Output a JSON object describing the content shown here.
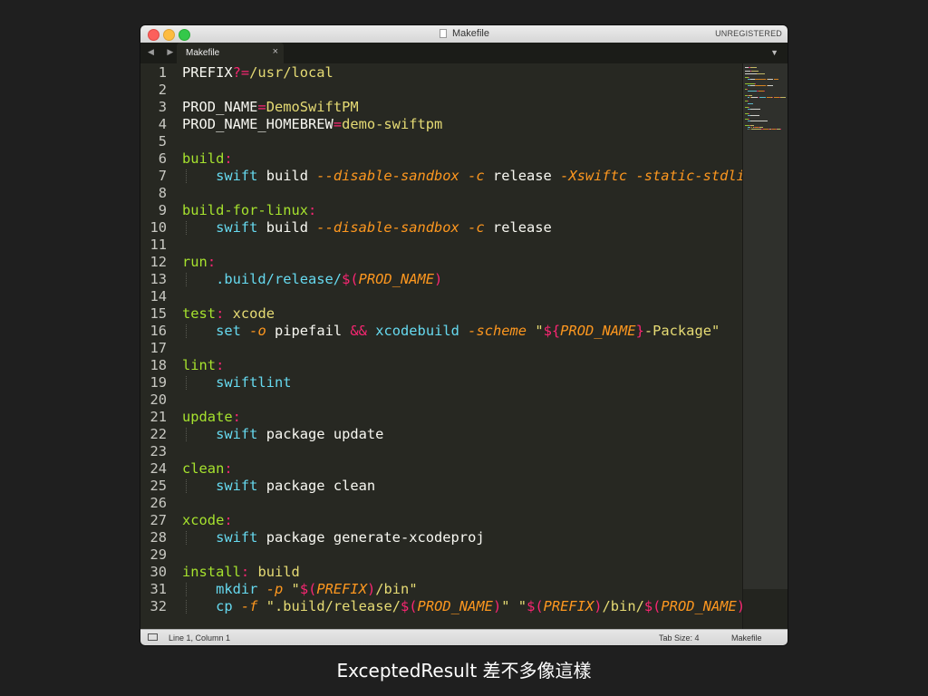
{
  "window": {
    "title": "Makefile",
    "registration": "UNREGISTERED"
  },
  "tabs": [
    {
      "label": "Makefile",
      "close": "×",
      "active": true
    }
  ],
  "tab_nav": {
    "arrows": "◀ ▶",
    "menu": "▼"
  },
  "code_lines": [
    {
      "n": "1",
      "tokens": [
        [
          "w",
          "PREFIX"
        ],
        [
          "p",
          "?="
        ],
        [
          "s",
          "/usr/local"
        ]
      ]
    },
    {
      "n": "2",
      "tokens": []
    },
    {
      "n": "3",
      "tokens": [
        [
          "w",
          "PROD_NAME"
        ],
        [
          "p",
          "="
        ],
        [
          "s",
          "DemoSwiftPM"
        ]
      ]
    },
    {
      "n": "4",
      "tokens": [
        [
          "w",
          "PROD_NAME_HOMEBREW"
        ],
        [
          "p",
          "="
        ],
        [
          "s",
          "demo-swiftpm"
        ]
      ]
    },
    {
      "n": "5",
      "tokens": []
    },
    {
      "n": "6",
      "tokens": [
        [
          "t",
          "build"
        ],
        [
          "p",
          ":"
        ]
      ]
    },
    {
      "n": "7",
      "guide": true,
      "tokens": [
        [
          "w",
          "    "
        ],
        [
          "c",
          "swift"
        ],
        [
          "w",
          " build "
        ],
        [
          "o",
          "--disable-sandbox"
        ],
        [
          "w",
          " "
        ],
        [
          "o",
          "-c"
        ],
        [
          "w",
          " release "
        ],
        [
          "o",
          "-Xswiftc"
        ],
        [
          "w",
          " "
        ],
        [
          "o",
          "-static-stdlib"
        ]
      ]
    },
    {
      "n": "8",
      "tokens": []
    },
    {
      "n": "9",
      "tokens": [
        [
          "t",
          "build-for-linux"
        ],
        [
          "p",
          ":"
        ]
      ]
    },
    {
      "n": "10",
      "guide": true,
      "tokens": [
        [
          "w",
          "    "
        ],
        [
          "c",
          "swift"
        ],
        [
          "w",
          " build "
        ],
        [
          "o",
          "--disable-sandbox"
        ],
        [
          "w",
          " "
        ],
        [
          "o",
          "-c"
        ],
        [
          "w",
          " release"
        ]
      ]
    },
    {
      "n": "11",
      "tokens": []
    },
    {
      "n": "12",
      "tokens": [
        [
          "t",
          "run"
        ],
        [
          "p",
          ":"
        ]
      ]
    },
    {
      "n": "13",
      "guide": true,
      "tokens": [
        [
          "w",
          "    "
        ],
        [
          "c",
          ".build/release/"
        ],
        [
          "p",
          "$("
        ],
        [
          "o",
          "PROD_NAME"
        ],
        [
          "p",
          ")"
        ]
      ]
    },
    {
      "n": "14",
      "tokens": []
    },
    {
      "n": "15",
      "tokens": [
        [
          "t",
          "test"
        ],
        [
          "p",
          ":"
        ],
        [
          "w",
          " "
        ],
        [
          "s",
          "xcode"
        ]
      ]
    },
    {
      "n": "16",
      "guide": true,
      "tokens": [
        [
          "w",
          "    "
        ],
        [
          "c",
          "set"
        ],
        [
          "w",
          " "
        ],
        [
          "o",
          "-o"
        ],
        [
          "w",
          " pipefail "
        ],
        [
          "p",
          "&&"
        ],
        [
          "w",
          " "
        ],
        [
          "c",
          "xcodebuild"
        ],
        [
          "w",
          " "
        ],
        [
          "o",
          "-scheme"
        ],
        [
          "w",
          " "
        ],
        [
          "s",
          "\""
        ],
        [
          "p",
          "${"
        ],
        [
          "o",
          "PROD_NAME"
        ],
        [
          "p",
          "}"
        ],
        [
          "s",
          "-Package\""
        ]
      ]
    },
    {
      "n": "17",
      "tokens": []
    },
    {
      "n": "18",
      "tokens": [
        [
          "t",
          "lint"
        ],
        [
          "p",
          ":"
        ]
      ]
    },
    {
      "n": "19",
      "guide": true,
      "tokens": [
        [
          "w",
          "    "
        ],
        [
          "c",
          "swiftlint"
        ]
      ]
    },
    {
      "n": "20",
      "tokens": []
    },
    {
      "n": "21",
      "tokens": [
        [
          "t",
          "update"
        ],
        [
          "p",
          ":"
        ]
      ]
    },
    {
      "n": "22",
      "guide": true,
      "tokens": [
        [
          "w",
          "    "
        ],
        [
          "c",
          "swift"
        ],
        [
          "w",
          " package update"
        ]
      ]
    },
    {
      "n": "23",
      "tokens": []
    },
    {
      "n": "24",
      "tokens": [
        [
          "t",
          "clean"
        ],
        [
          "p",
          ":"
        ]
      ]
    },
    {
      "n": "25",
      "guide": true,
      "tokens": [
        [
          "w",
          "    "
        ],
        [
          "c",
          "swift"
        ],
        [
          "w",
          " package clean"
        ]
      ]
    },
    {
      "n": "26",
      "tokens": []
    },
    {
      "n": "27",
      "tokens": [
        [
          "t",
          "xcode"
        ],
        [
          "p",
          ":"
        ]
      ]
    },
    {
      "n": "28",
      "guide": true,
      "tokens": [
        [
          "w",
          "    "
        ],
        [
          "c",
          "swift"
        ],
        [
          "w",
          " package generate-xcodeproj"
        ]
      ]
    },
    {
      "n": "29",
      "tokens": []
    },
    {
      "n": "30",
      "tokens": [
        [
          "t",
          "install"
        ],
        [
          "p",
          ":"
        ],
        [
          "w",
          " "
        ],
        [
          "s",
          "build"
        ]
      ]
    },
    {
      "n": "31",
      "guide": true,
      "tokens": [
        [
          "w",
          "    "
        ],
        [
          "c",
          "mkdir"
        ],
        [
          "w",
          " "
        ],
        [
          "o",
          "-p"
        ],
        [
          "w",
          " "
        ],
        [
          "s",
          "\""
        ],
        [
          "p",
          "$("
        ],
        [
          "o",
          "PREFIX"
        ],
        [
          "p",
          ")"
        ],
        [
          "s",
          "/bin\""
        ]
      ]
    },
    {
      "n": "32",
      "guide": true,
      "tokens": [
        [
          "w",
          "    "
        ],
        [
          "c",
          "cp"
        ],
        [
          "w",
          " "
        ],
        [
          "o",
          "-f"
        ],
        [
          "w",
          " "
        ],
        [
          "s",
          "\".build/release/"
        ],
        [
          "p",
          "$("
        ],
        [
          "o",
          "PROD_NAME"
        ],
        [
          "p",
          ")"
        ],
        [
          "s",
          "\""
        ],
        [
          "w",
          " "
        ],
        [
          "s",
          "\""
        ],
        [
          "p",
          "$("
        ],
        [
          "o",
          "PREFIX"
        ],
        [
          "p",
          ")"
        ],
        [
          "s",
          "/bin/"
        ],
        [
          "p",
          "$("
        ],
        [
          "o",
          "PROD_NAME"
        ],
        [
          "p",
          ")"
        ],
        [
          "s",
          "\""
        ]
      ]
    }
  ],
  "colors": {
    "background": "#272822",
    "target": "#a6e22e",
    "operator": "#f92672",
    "string": "#e6db74",
    "command": "#66d9ef",
    "option": "#fd971f",
    "text": "#f8f8f2"
  },
  "statusbar": {
    "icon": "panel-icon",
    "position": "Line 1, Column 1",
    "tab_size": "Tab Size: 4",
    "syntax": "Makefile"
  },
  "caption": "ExceptedResult 差不多像這樣"
}
